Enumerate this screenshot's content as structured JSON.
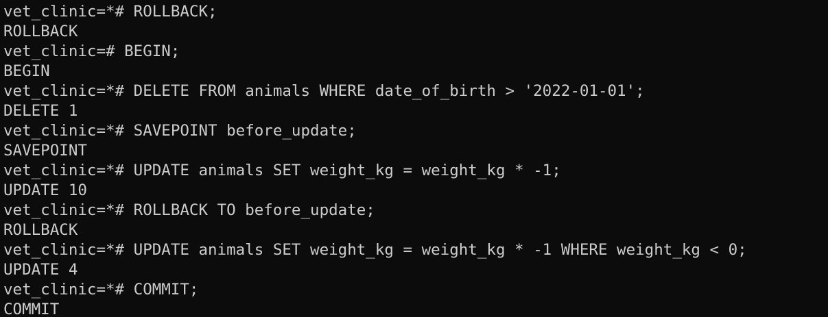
{
  "terminal": {
    "lines": [
      "vet_clinic=*# ROLLBACK;",
      "ROLLBACK",
      "vet_clinic=# BEGIN;",
      "BEGIN",
      "vet_clinic=*# DELETE FROM animals WHERE date_of_birth > '2022-01-01';",
      "DELETE 1",
      "vet_clinic=*# SAVEPOINT before_update;",
      "SAVEPOINT",
      "vet_clinic=*# UPDATE animals SET weight_kg = weight_kg * -1;",
      "UPDATE 10",
      "vet_clinic=*# ROLLBACK TO before_update;",
      "ROLLBACK",
      "vet_clinic=*# UPDATE animals SET weight_kg = weight_kg * -1 WHERE weight_kg < 0;",
      "UPDATE 4",
      "vet_clinic=*# COMMIT;",
      "COMMIT"
    ]
  },
  "colors": {
    "background": "#0c0c0c",
    "foreground": "#cccccc"
  }
}
